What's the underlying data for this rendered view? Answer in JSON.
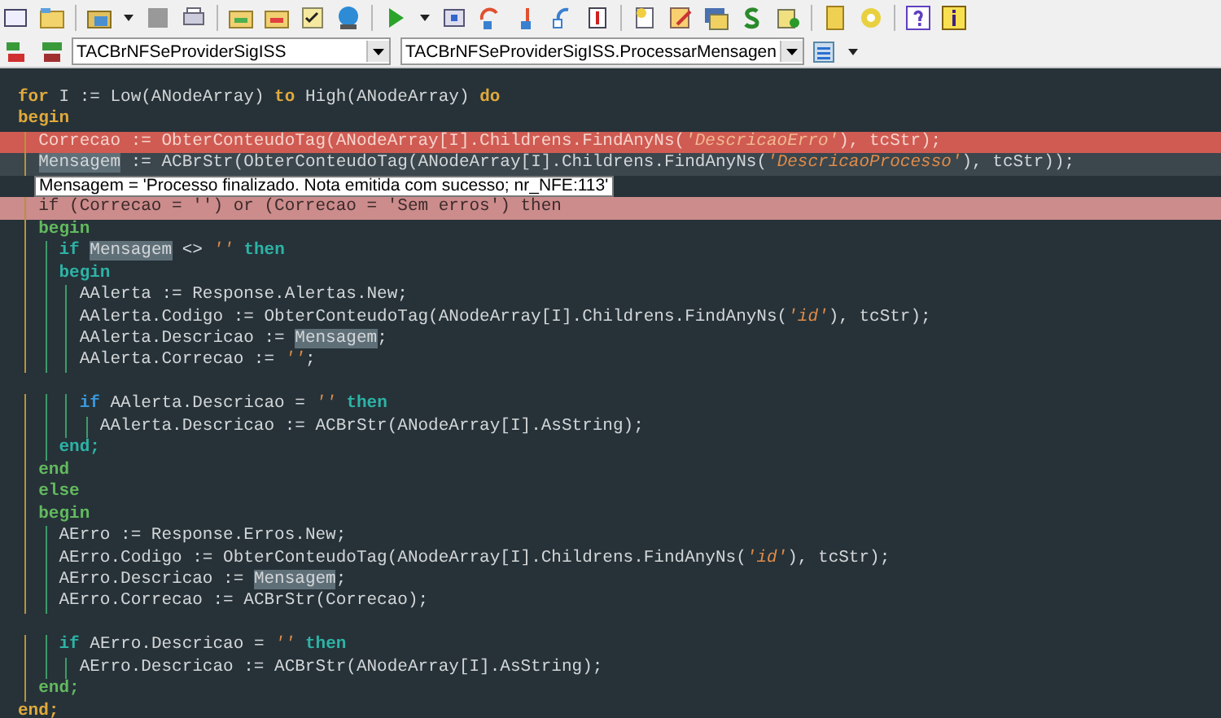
{
  "toolbar": {
    "class_combo": {
      "value": "TACBrNFSeProviderSigISS"
    },
    "method_combo": {
      "value": "TACBrNFSeProviderSigISS.ProcessarMensagen"
    }
  },
  "editor": {
    "lines": [
      {
        "kind": "plain",
        "tokens": [
          {
            "text": "for",
            "kind": "gold"
          },
          {
            "text": " I := Low(ANodeArray) ",
            "kind": "ident"
          },
          {
            "text": "to",
            "kind": "gold"
          },
          {
            "text": " High(ANodeArray) ",
            "kind": "ident"
          },
          {
            "text": "do",
            "kind": "gold"
          }
        ]
      },
      {
        "kind": "plain",
        "tokens": [
          {
            "text": "begin",
            "kind": "gold"
          }
        ]
      },
      {
        "kind": "error",
        "tokens": [
          {
            "text": "  Correcao := ObterConteudoTag(ANodeArray[I].Childrens.FindAnyNs(",
            "kind": "ident"
          },
          {
            "text": "'DescricaoErro'",
            "kind": "string"
          },
          {
            "text": "), tcStr);",
            "kind": "ident"
          }
        ]
      },
      {
        "kind": "current",
        "tokens": [
          {
            "text": "  Mensagem",
            "kind": "mark"
          },
          {
            "text": " := ACBrStr(ObterConteudoTag(ANodeArray[I].Childrens.FindAnyNs(",
            "kind": "ident"
          },
          {
            "text": "'DescricaoProcesso'",
            "kind": "string"
          },
          {
            "text": "), tcStr));",
            "kind": "ident"
          }
        ]
      },
      {
        "kind": "plain",
        "tooltip": "Mensagem = 'Processo finalizado. Nota emitida com sucesso; nr_NFE:113'"
      },
      {
        "kind": "breakpoint",
        "tokens": [
          {
            "text": "  if (Correcao = '') or (Correcao = 'Sem erros') then",
            "kind": "ident"
          }
        ]
      },
      {
        "kind": "plain",
        "tokens": [
          {
            "text": "  begin",
            "kind": "green"
          }
        ]
      },
      {
        "kind": "plain",
        "tokens": [
          {
            "text": "    if",
            "kind": "teal"
          },
          {
            "text": " Mensagem",
            "kind": "mark"
          },
          {
            "text": " <> ",
            "kind": "ident"
          },
          {
            "text": "''",
            "kind": "string"
          },
          {
            "text": " then",
            "kind": "teal"
          }
        ]
      },
      {
        "kind": "plain",
        "tokens": [
          {
            "text": "    begin",
            "kind": "teal"
          }
        ]
      },
      {
        "kind": "plain",
        "tokens": [
          {
            "text": "      AAlerta := Response.Alertas.New;",
            "kind": "ident"
          }
        ]
      },
      {
        "kind": "plain",
        "tokens": [
          {
            "text": "      AAlerta.Codigo := ObterConteudoTag(ANodeArray[I].Childrens.FindAnyNs(",
            "kind": "ident"
          },
          {
            "text": "'id'",
            "kind": "string"
          },
          {
            "text": "), tcStr);",
            "kind": "ident"
          }
        ]
      },
      {
        "kind": "plain",
        "tokens": [
          {
            "text": "      AAlerta.Descricao := ",
            "kind": "ident"
          },
          {
            "text": "Mensagem",
            "kind": "mark"
          },
          {
            "text": ";",
            "kind": "ident"
          }
        ]
      },
      {
        "kind": "plain",
        "tokens": [
          {
            "text": "      AAlerta.Correcao := ",
            "kind": "ident"
          },
          {
            "text": "''",
            "kind": "string"
          },
          {
            "text": ";",
            "kind": "ident"
          }
        ]
      },
      {
        "kind": "plain"
      },
      {
        "kind": "plain",
        "tokens": [
          {
            "text": "      if",
            "kind": "blue"
          },
          {
            "text": " AAlerta.Descricao = ",
            "kind": "ident"
          },
          {
            "text": "''",
            "kind": "string"
          },
          {
            "text": " then",
            "kind": "teal"
          }
        ]
      },
      {
        "kind": "plain",
        "tokens": [
          {
            "text": "        AAlerta.Descricao := ACBrStr(ANodeArray[I].AsString);",
            "kind": "ident"
          }
        ]
      },
      {
        "kind": "plain",
        "tokens": [
          {
            "text": "    end;",
            "kind": "teal"
          }
        ]
      },
      {
        "kind": "plain",
        "tokens": [
          {
            "text": "  end",
            "kind": "green"
          }
        ]
      },
      {
        "kind": "plain",
        "tokens": [
          {
            "text": "  else",
            "kind": "green"
          }
        ]
      },
      {
        "kind": "plain",
        "tokens": [
          {
            "text": "  begin",
            "kind": "green"
          }
        ]
      },
      {
        "kind": "plain",
        "tokens": [
          {
            "text": "    AErro := Response.Erros.New;",
            "kind": "ident"
          }
        ]
      },
      {
        "kind": "plain",
        "tokens": [
          {
            "text": "    AErro.Codigo := ObterConteudoTag(ANodeArray[I].Childrens.FindAnyNs(",
            "kind": "ident"
          },
          {
            "text": "'id'",
            "kind": "string"
          },
          {
            "text": "), tcStr);",
            "kind": "ident"
          }
        ]
      },
      {
        "kind": "plain",
        "tokens": [
          {
            "text": "    AErro.Descricao := ",
            "kind": "ident"
          },
          {
            "text": "Mensagem",
            "kind": "mark"
          },
          {
            "text": ";",
            "kind": "ident"
          }
        ]
      },
      {
        "kind": "plain",
        "tokens": [
          {
            "text": "    AErro.Correcao := ACBrStr(Correcao);",
            "kind": "ident"
          }
        ]
      },
      {
        "kind": "plain"
      },
      {
        "kind": "plain",
        "tokens": [
          {
            "text": "    if",
            "kind": "teal"
          },
          {
            "text": " AErro.Descricao = ",
            "kind": "ident"
          },
          {
            "text": "''",
            "kind": "string"
          },
          {
            "text": " then",
            "kind": "teal"
          }
        ]
      },
      {
        "kind": "plain",
        "tokens": [
          {
            "text": "      AErro.Descricao := ACBrStr(ANodeArray[I].AsString);",
            "kind": "ident"
          }
        ]
      },
      {
        "kind": "plain",
        "tokens": [
          {
            "text": "  end;",
            "kind": "green"
          }
        ]
      },
      {
        "kind": "plain",
        "tokens": [
          {
            "text": "end;",
            "kind": "gold"
          }
        ]
      }
    ]
  }
}
